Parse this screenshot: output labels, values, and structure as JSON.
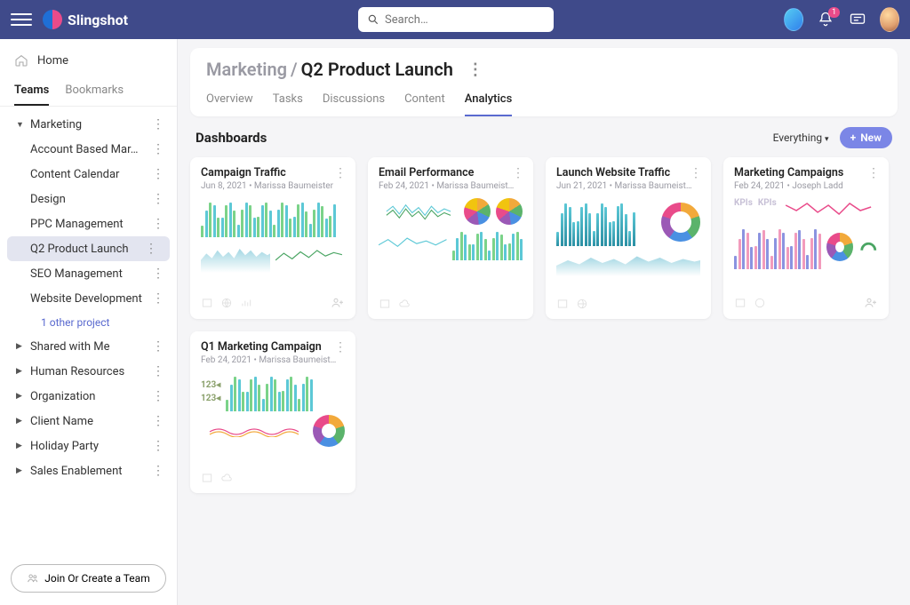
{
  "app": {
    "name": "Slingshot"
  },
  "search": {
    "placeholder": "Search…"
  },
  "notifications": {
    "count": 1
  },
  "sidebar": {
    "home": "Home",
    "tabs": [
      "Teams",
      "Bookmarks"
    ],
    "activeTab": 0,
    "tree": {
      "expanded": "Marketing",
      "children": [
        "Account Based Mar…",
        "Content Calendar",
        "Design",
        "PPC Management",
        "Q2 Product Launch",
        "SEO Management",
        "Website Development"
      ],
      "more_link": "1 other project",
      "others": [
        "Shared with Me",
        "Human Resources",
        "Organization",
        "Client Name",
        "Holiday Party",
        "Sales Enablement"
      ]
    },
    "join_button": "Join Or Create a Team"
  },
  "breadcrumb": {
    "parent": "Marketing",
    "sep": "/",
    "current": "Q2 Product Launch"
  },
  "page_tabs": [
    "Overview",
    "Tasks",
    "Discussions",
    "Content",
    "Analytics"
  ],
  "page_active_tab": 4,
  "dashboards": {
    "title": "Dashboards",
    "filter": "Everything",
    "new_button": "New",
    "cards": [
      {
        "title": "Campaign Traffic",
        "meta": "Jun 8, 2021 • Marissa Baumeister"
      },
      {
        "title": "Email Performance",
        "meta": "Feb 24, 2021 • Marissa Baumeist…"
      },
      {
        "title": "Launch Website Traffic",
        "meta": "Jun 21, 2021 • Marissa Baumeist…"
      },
      {
        "title": "Marketing Campaigns",
        "meta": "Feb 24, 2021 • Joseph Ladd"
      },
      {
        "title": "Q1 Marketing Campaign",
        "meta": "Feb 24, 2021 • Marissa Baumeist…"
      }
    ]
  },
  "kpi_label": "KPIs",
  "mini_number": "123"
}
